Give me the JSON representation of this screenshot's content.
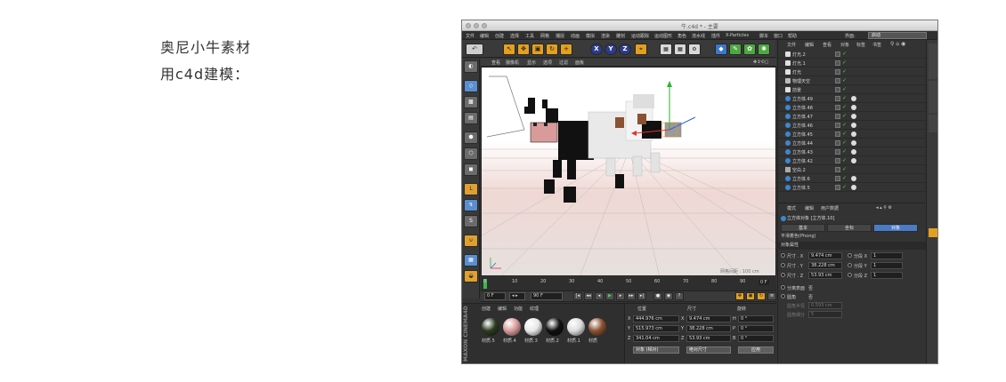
{
  "notes": [
    "奥尼小牛素材",
    "用c4d建模："
  ],
  "window": {
    "title": "牛.c4d * - 主要",
    "menu": [
      "文件",
      "编辑",
      "创建",
      "选择",
      "工具",
      "网格",
      "捕捉",
      "动画",
      "模拟",
      "渲染",
      "雕刻",
      "运动跟踪",
      "运动图形",
      "角色",
      "流水线",
      "插件",
      "X-Particles",
      "脚本",
      "窗口",
      "帮助"
    ],
    "interface_label": "界面:",
    "interface_value": "启动"
  },
  "toolbar": {
    "axis_buttons": [
      "X",
      "Y",
      "Z"
    ]
  },
  "viewport": {
    "menu": [
      "查看",
      "摄像机",
      "显示",
      "选项",
      "过滤",
      "面板"
    ],
    "grid_label": "网格间距 : 100 cm"
  },
  "timeline": {
    "ticks": [
      "0",
      "10",
      "20",
      "30",
      "40",
      "50",
      "60",
      "70",
      "80",
      "90"
    ],
    "end_frame": "0 F"
  },
  "transport": {
    "current_frame": "0 F",
    "end_field": "90 F"
  },
  "materials": {
    "menu": [
      "创建",
      "编辑",
      "功能",
      "纹理"
    ],
    "items": [
      {
        "name": "材质.5",
        "color": "#2d3a22"
      },
      {
        "name": "材质.4",
        "color": "#d89a9a"
      },
      {
        "name": "材质.3",
        "color": "#e8e8e8"
      },
      {
        "name": "材质.2",
        "color": "#111111"
      },
      {
        "name": "材质.1",
        "color": "#dcdcdc"
      },
      {
        "name": "材质",
        "color": "#8a5232"
      }
    ],
    "brand": "MAXON CINEMA4D"
  },
  "coordinates": {
    "headers": [
      "位置",
      "尺寸",
      "旋转"
    ],
    "rows": [
      {
        "axis": "X",
        "pos": "444.976 cm",
        "size": "9.474 cm",
        "rot_axis": "H",
        "rot": "0 °"
      },
      {
        "axis": "Y",
        "pos": "515.973 cm",
        "size": "38.228 cm",
        "rot_axis": "P",
        "rot": "0 °"
      },
      {
        "axis": "Z",
        "pos": "341.04 cm",
        "size": "53.93 cm",
        "rot_axis": "B",
        "rot": "0 °"
      }
    ],
    "mode_select": "对象 (相对)",
    "size_select": "绝对尺寸",
    "apply": "应用"
  },
  "objects": {
    "menu": [
      "文件",
      "编辑",
      "查看",
      "对象",
      "标签",
      "书签"
    ],
    "items": [
      {
        "name": "灯光.2",
        "type": "light"
      },
      {
        "name": "灯光.1",
        "type": "light"
      },
      {
        "name": "灯光",
        "type": "light"
      },
      {
        "name": "物理天空",
        "type": "sky"
      },
      {
        "name": "前景",
        "type": "light"
      },
      {
        "name": "立方体.49",
        "type": "cube"
      },
      {
        "name": "立方体.48",
        "type": "cube"
      },
      {
        "name": "立方体.47",
        "type": "cube"
      },
      {
        "name": "立方体.46",
        "type": "cube"
      },
      {
        "name": "立方体.45",
        "type": "cube"
      },
      {
        "name": "立方体.44",
        "type": "cube"
      },
      {
        "name": "立方体.43",
        "type": "cube"
      },
      {
        "name": "立方体.42",
        "type": "cube"
      },
      {
        "name": "空白.2",
        "type": "null"
      },
      {
        "name": "立方体.6",
        "type": "cube"
      },
      {
        "name": "立方体.5",
        "type": "cube"
      }
    ]
  },
  "attributes": {
    "menu": [
      "模式",
      "编辑",
      "用户数据"
    ],
    "title": "立方体对象 [立方体.10]",
    "tabs": [
      "基本",
      "坐标",
      "对象"
    ],
    "active_tab": "对象",
    "sub": "平滑着色(Phong)",
    "section": "对象属性",
    "rows": [
      {
        "label": "尺寸 . X",
        "value": "9.474 cm",
        "seg_label": "分段 X",
        "seg": "1"
      },
      {
        "label": "尺寸 . Y",
        "value": "38.228 cm",
        "seg_label": "分段 Y",
        "seg": "1"
      },
      {
        "label": "尺寸 . Z",
        "value": "53.93 cm",
        "seg_label": "分段 Z",
        "seg": "1"
      }
    ],
    "sep_faces": "分离表面",
    "fillet": "圆角",
    "no": "否",
    "fillet_radius_label": "圆角半径",
    "fillet_radius": "0.593 cm",
    "fillet_seg_label": "圆角细分",
    "fillet_seg": "5"
  },
  "colors": {
    "accent_blue": "#4a7bc4",
    "accent_orange": "#e3a020",
    "panel_bg": "#333333"
  }
}
